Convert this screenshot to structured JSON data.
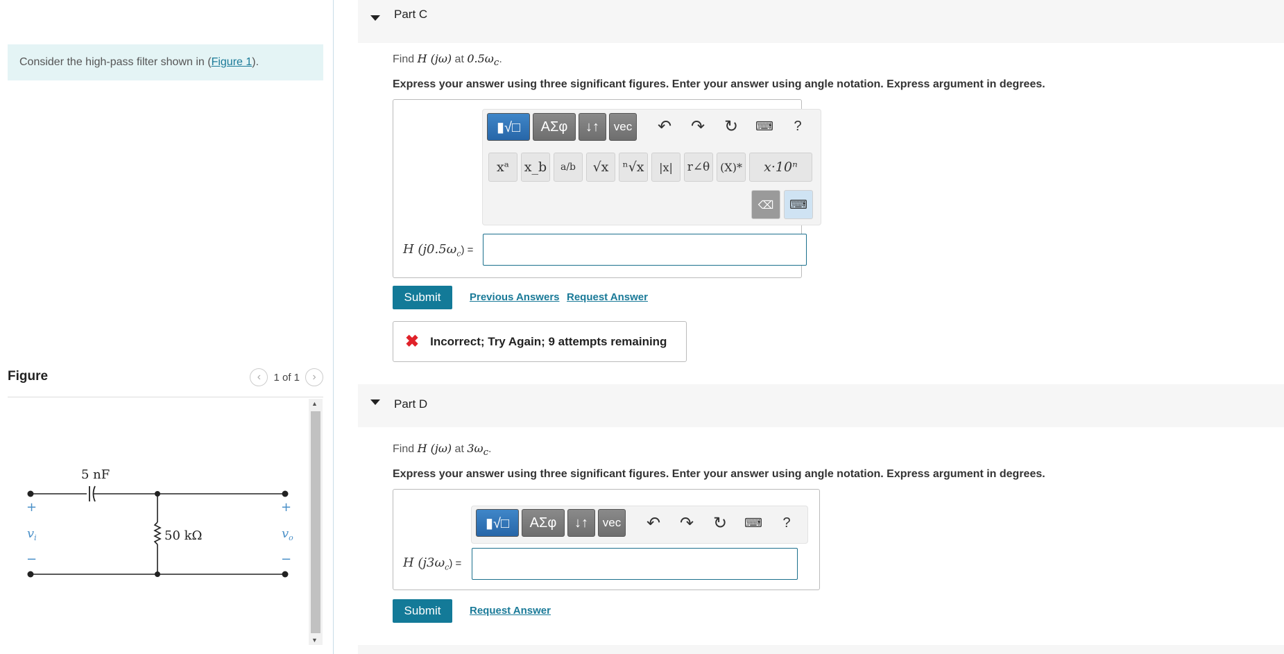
{
  "left": {
    "intro_prefix": "Consider the high-pass filter shown in (",
    "intro_link": "Figure 1",
    "intro_suffix": ").",
    "figure_title": "Figure",
    "pager_text": "1 of 1",
    "circuit": {
      "capacitor": "5 nF",
      "resistor": "50 kΩ",
      "vi": "v",
      "vi_sub": "i",
      "vo": "v",
      "vo_sub": "o",
      "plus": "+",
      "minus": "−"
    }
  },
  "partC": {
    "title": "Part C",
    "question_prefix": "Find ",
    "question_math": "H (jω)",
    "question_mid": " at ",
    "question_math2": "0.5ω",
    "question_sub": "c",
    "question_suffix": ".",
    "instructions": "Express your answer using three significant figures. Enter your answer using angle notation. Express argument in degrees.",
    "eq_label_math": "H (j0.5ω",
    "eq_label_sub": "c",
    "eq_label_end": ") =",
    "submit": "Submit",
    "previous_answers": "Previous Answers",
    "request_answer": "Request Answer",
    "feedback": "Incorrect; Try Again; 9 attempts remaining"
  },
  "partD": {
    "title": "Part D",
    "question_prefix": "Find ",
    "question_math": "H (jω)",
    "question_mid": " at ",
    "question_math2": "3ω",
    "question_sub": "c",
    "question_suffix": ".",
    "instructions": "Express your answer using three significant figures. Enter your answer using angle notation. Express argument in degrees.",
    "eq_label_math": "H (j3ω",
    "eq_label_sub": "c",
    "eq_label_end": ") =",
    "submit": "Submit",
    "request_answer": "Request Answer"
  },
  "toolbar": {
    "templates": "▮√□",
    "greek": "ΑΣφ",
    "arrows": "↓↑",
    "vec": "vec",
    "help": "?",
    "keys": [
      "xᵃ",
      "x_b",
      "a/b",
      "√x",
      "ⁿ√x",
      "|x|",
      "r∠θ",
      "(X)*",
      "x·10ⁿ"
    ]
  }
}
